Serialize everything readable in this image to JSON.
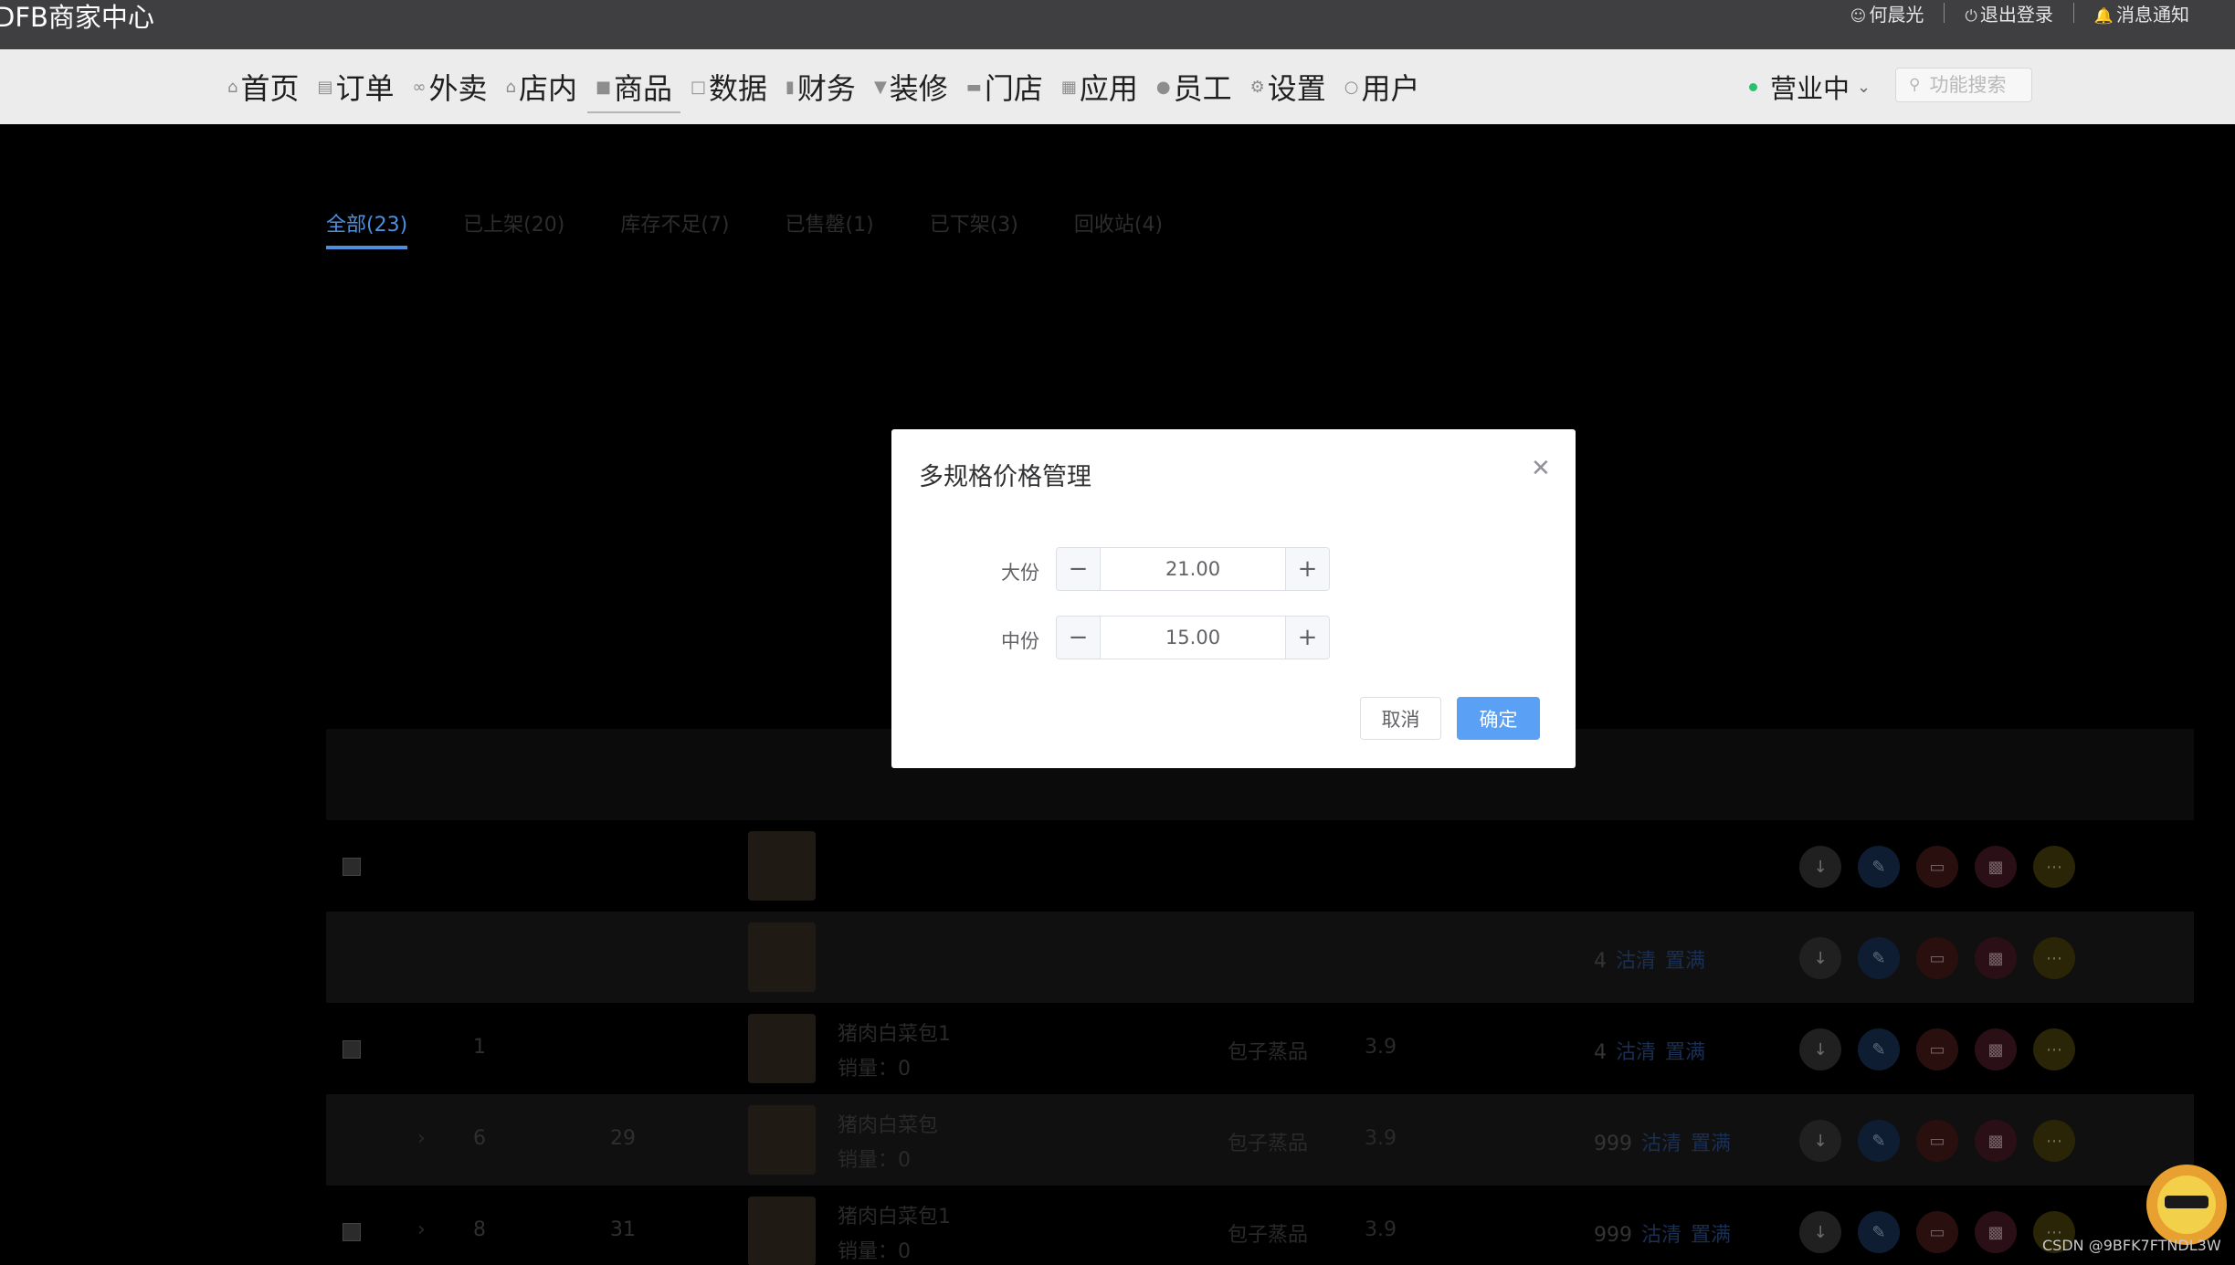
{
  "header": {
    "brand": "DFB商家中心",
    "user": "何晨光",
    "logout": "退出登录",
    "notifications": "消息通知"
  },
  "nav": {
    "items": [
      "首页",
      "订单",
      "外卖",
      "店内",
      "商品",
      "数据",
      "财务",
      "装修",
      "门店",
      "应用",
      "员工",
      "设置",
      "用户"
    ],
    "active": "商品",
    "status": "营业中",
    "search_placeholder": "功能搜索"
  },
  "tabs": [
    {
      "label": "全部(23)",
      "active": true
    },
    {
      "label": "已上架(20)",
      "active": false
    },
    {
      "label": "库存不足(7)",
      "active": false
    },
    {
      "label": "已售罄(1)",
      "active": false
    },
    {
      "label": "已下架(3)",
      "active": false
    },
    {
      "label": "回收站(4)",
      "active": false
    }
  ],
  "table": {
    "rows": [
      {
        "code": "",
        "num": "",
        "name": "",
        "sales": "",
        "category": "",
        "price": "",
        "stock": "",
        "clear": "",
        "fill": ""
      },
      {
        "code": "",
        "num": "",
        "name": "",
        "sales": "",
        "category": "",
        "price": "",
        "stock": "4",
        "clear": "沽清",
        "fill": "置满"
      },
      {
        "code": "1",
        "num": "",
        "name": "猪肉白菜包1",
        "sales": "销量：0",
        "category": "包子蒸品",
        "price": "3.9",
        "stock": "4",
        "clear": "沽清",
        "fill": "置满"
      },
      {
        "code": "6",
        "num": "29",
        "name": "猪肉白菜包",
        "sales": "销量：0",
        "category": "包子蒸品",
        "price": "3.9",
        "stock": "999",
        "clear": "沽清",
        "fill": "置满"
      },
      {
        "code": "8",
        "num": "31",
        "name": "猪肉白菜包1",
        "sales": "销量：0",
        "category": "包子蒸品",
        "price": "3.9",
        "stock": "999",
        "clear": "沽清",
        "fill": "置满"
      }
    ]
  },
  "dialog": {
    "title": "多规格价格管理",
    "specs": [
      {
        "label": "大份",
        "value": "21.00"
      },
      {
        "label": "中份",
        "value": "15.00"
      }
    ],
    "cancel": "取消",
    "confirm": "确定"
  },
  "colors": {
    "accent": "#4d8fe0",
    "primary_button": "#5aa1f5",
    "topbar": "#3f3f42",
    "navbar": "#ececec",
    "online_dot": "#25c36b"
  },
  "watermark": "CSDN @9BFK7FTNDL3W"
}
